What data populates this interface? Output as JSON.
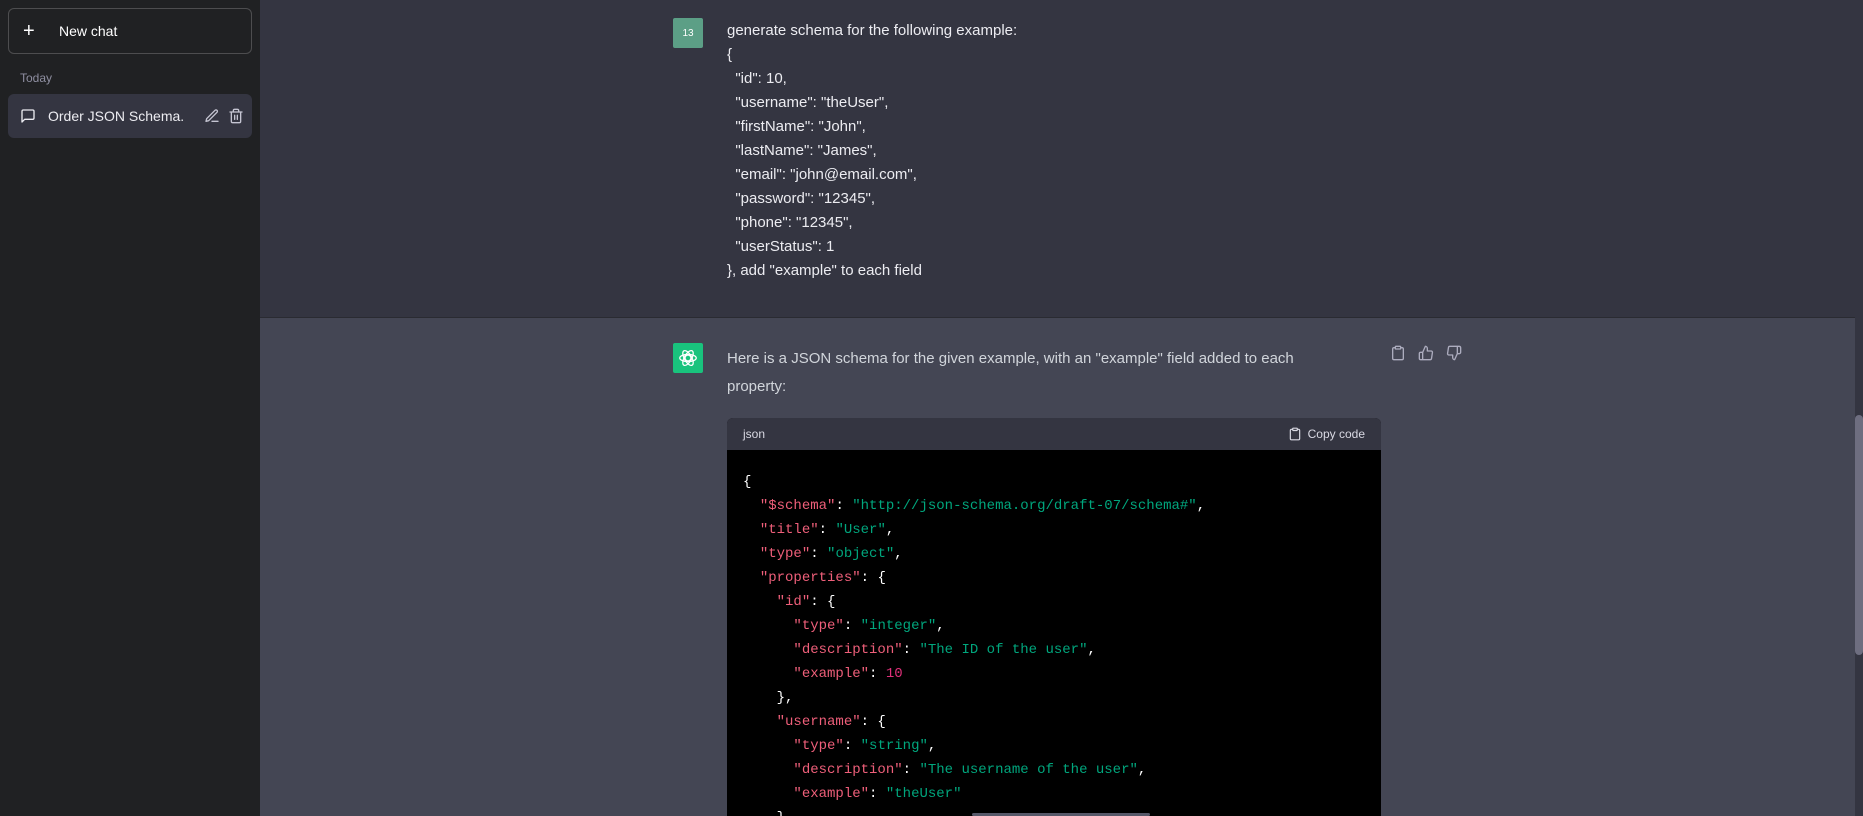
{
  "sidebar": {
    "new_chat_label": "New chat",
    "section_label": "Today",
    "chat_item_label": "Order JSON Schema."
  },
  "user_message": {
    "avatar_text": "13",
    "text": "generate schema for the following example:\n{\n  \"id\": 10,\n  \"username\": \"theUser\",\n  \"firstName\": \"John\",\n  \"lastName\": \"James\",\n  \"email\": \"john@email.com\",\n  \"password\": \"12345\",\n  \"phone\": \"12345\",\n  \"userStatus\": 1\n}, add \"example\" to each field"
  },
  "assistant_message": {
    "intro": "Here is a JSON schema for the given example, with an \"example\" field added to each property:",
    "code_lang": "json",
    "copy_label": "Copy code",
    "code_lines": [
      [
        [
          "p",
          "{"
        ]
      ],
      [
        [
          "p",
          "  "
        ],
        [
          "k",
          "\"$schema\""
        ],
        [
          "p",
          ": "
        ],
        [
          "s",
          "\"http://json-schema.org/draft-07/schema#\""
        ],
        [
          "p",
          ","
        ]
      ],
      [
        [
          "p",
          "  "
        ],
        [
          "k",
          "\"title\""
        ],
        [
          "p",
          ": "
        ],
        [
          "s",
          "\"User\""
        ],
        [
          "p",
          ","
        ]
      ],
      [
        [
          "p",
          "  "
        ],
        [
          "k",
          "\"type\""
        ],
        [
          "p",
          ": "
        ],
        [
          "s",
          "\"object\""
        ],
        [
          "p",
          ","
        ]
      ],
      [
        [
          "p",
          "  "
        ],
        [
          "k",
          "\"properties\""
        ],
        [
          "p",
          ": {"
        ]
      ],
      [
        [
          "p",
          "    "
        ],
        [
          "k",
          "\"id\""
        ],
        [
          "p",
          ": {"
        ]
      ],
      [
        [
          "p",
          "      "
        ],
        [
          "k",
          "\"type\""
        ],
        [
          "p",
          ": "
        ],
        [
          "s",
          "\"integer\""
        ],
        [
          "p",
          ","
        ]
      ],
      [
        [
          "p",
          "      "
        ],
        [
          "k",
          "\"description\""
        ],
        [
          "p",
          ": "
        ],
        [
          "s",
          "\"The ID of the user\""
        ],
        [
          "p",
          ","
        ]
      ],
      [
        [
          "p",
          "      "
        ],
        [
          "k",
          "\"example\""
        ],
        [
          "p",
          ": "
        ],
        [
          "n",
          "10"
        ]
      ],
      [
        [
          "p",
          "    },"
        ]
      ],
      [
        [
          "p",
          "    "
        ],
        [
          "k",
          "\"username\""
        ],
        [
          "p",
          ": {"
        ]
      ],
      [
        [
          "p",
          "      "
        ],
        [
          "k",
          "\"type\""
        ],
        [
          "p",
          ": "
        ],
        [
          "s",
          "\"string\""
        ],
        [
          "p",
          ","
        ]
      ],
      [
        [
          "p",
          "      "
        ],
        [
          "k",
          "\"description\""
        ],
        [
          "p",
          ": "
        ],
        [
          "s",
          "\"The username of the user\""
        ],
        [
          "p",
          ","
        ]
      ],
      [
        [
          "p",
          "      "
        ],
        [
          "k",
          "\"example\""
        ],
        [
          "p",
          ": "
        ],
        [
          "s",
          "\"theUser\""
        ]
      ],
      [
        [
          "p",
          "    },"
        ]
      ]
    ]
  },
  "colors": {
    "sidebar_bg": "#202123",
    "user_bg": "#343541",
    "assistant_bg": "#444654",
    "user_avatar": "#5c9f86",
    "bot_avatar": "#19c37d"
  },
  "icons": {
    "new_chat": "plus-icon",
    "chat_item": "message-icon",
    "edit": "pencil-icon",
    "delete": "trash-icon",
    "copy": "clipboard-icon",
    "thumbs_up": "thumbs-up-icon",
    "thumbs_down": "thumbs-down-icon",
    "bot": "openai-logo-icon"
  }
}
